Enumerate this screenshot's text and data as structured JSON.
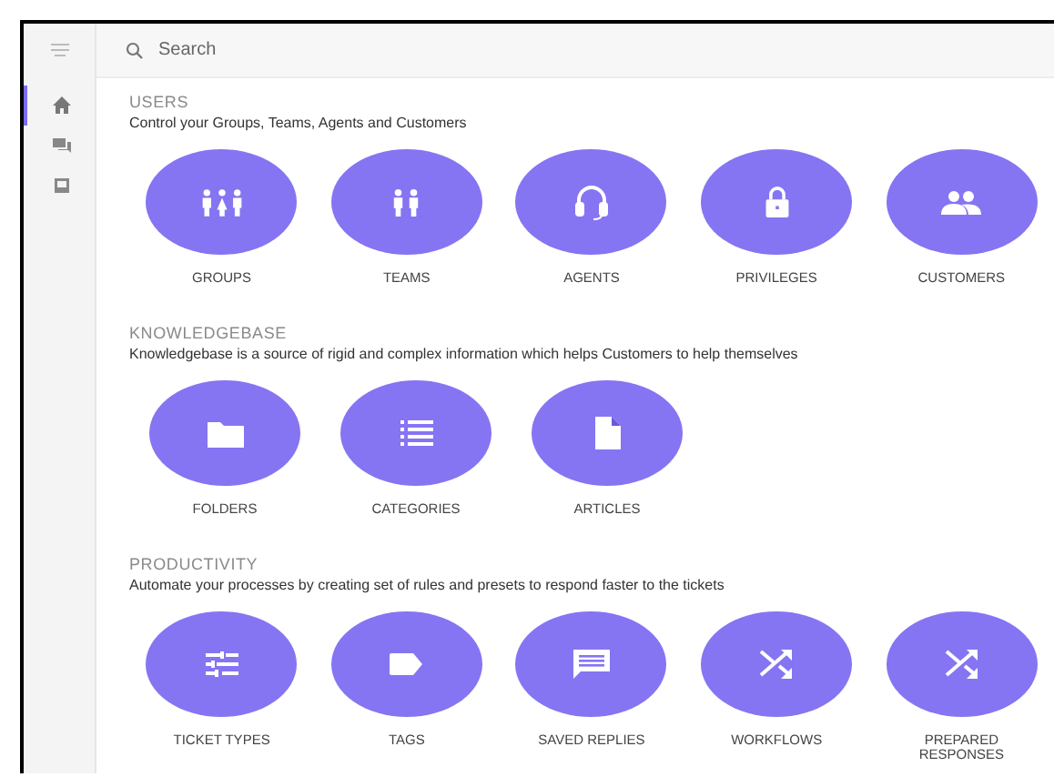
{
  "sidebar": {
    "items": [
      {
        "selected": true
      },
      {
        "selected": false
      },
      {
        "selected": false
      }
    ]
  },
  "search": {
    "placeholder": "Search"
  },
  "sections": [
    {
      "title": "USERS",
      "description": "Control your Groups, Teams, Agents and Customers",
      "tiles": [
        {
          "label": "GROUPS"
        },
        {
          "label": "TEAMS"
        },
        {
          "label": "AGENTS"
        },
        {
          "label": "PRIVILEGES"
        },
        {
          "label": "CUSTOMERS"
        }
      ]
    },
    {
      "title": "KNOWLEDGEBASE",
      "description": "Knowledgebase is a source of rigid and complex information which helps Customers to help themselves",
      "tiles": [
        {
          "label": "FOLDERS"
        },
        {
          "label": "CATEGORIES"
        },
        {
          "label": "ARTICLES"
        }
      ]
    },
    {
      "title": "PRODUCTIVITY",
      "description": "Automate your processes by creating set of rules and presets to respond faster to the tickets",
      "tiles": [
        {
          "label": "TICKET TYPES"
        },
        {
          "label": "TAGS"
        },
        {
          "label": "SAVED REPLIES"
        },
        {
          "label": "WORKFLOWS"
        },
        {
          "label": "PREPARED RESPONSES"
        }
      ]
    }
  ]
}
